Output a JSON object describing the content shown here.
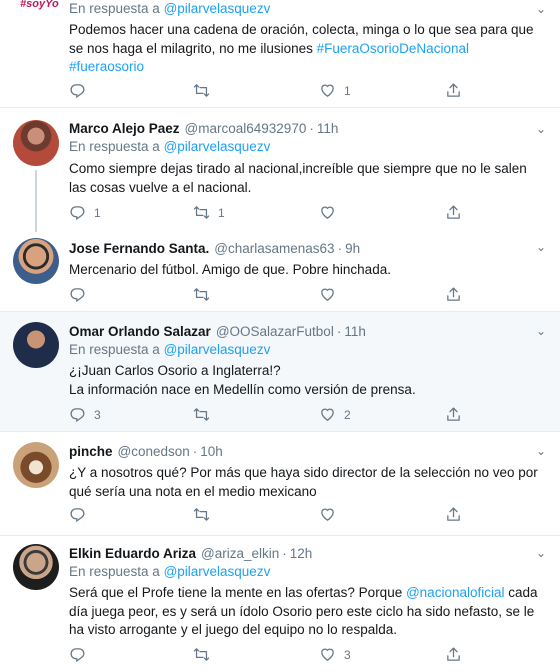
{
  "tweets": [
    {
      "name": "",
      "handle": "",
      "time": "",
      "replying_prefix": "En respuesta a ",
      "replying_to": "@pilarvelasquezv",
      "text_plain": "Podemos hacer una cadena de oración, colecta, minga o lo que sea para que se nos haga el milagrito, no me ilusiones ",
      "text_link1": "#FueraOsorioDeNacional",
      "text_link2": "#fueraosorio",
      "reply_count": "",
      "retweet_count": "",
      "like_count": "1",
      "avatar_text": "#soyYo"
    },
    {
      "name": "Marco Alejo Paez",
      "handle": "@marcoal64932970",
      "time": "11h",
      "replying_prefix": "En respuesta a ",
      "replying_to": "@pilarvelasquezv",
      "text_plain": "Como siempre dejas tirado al nacional,increíble que siempre que no le salen las cosas vuelve a el nacional.",
      "reply_count": "1",
      "retweet_count": "1",
      "like_count": ""
    },
    {
      "name": "Jose Fernando Santa.",
      "handle": "@charlasamenas63",
      "time": "9h",
      "text_plain": "Mercenario del fútbol. Amigo de que. Pobre hinchada.",
      "reply_count": "",
      "retweet_count": "",
      "like_count": ""
    },
    {
      "name": "Omar Orlando Salazar",
      "handle": "@OOSalazarFutbol",
      "time": "11h",
      "replying_prefix": "En respuesta a ",
      "replying_to": "@pilarvelasquezv",
      "text_plain": "¿¡Juan Carlos Osorio a Inglaterra!?\nLa información nace en Medellín como versión de prensa.",
      "reply_count": "3",
      "retweet_count": "",
      "like_count": "2"
    },
    {
      "name": "pinche",
      "handle": "@conedson",
      "time": "10h",
      "text_plain": "¿Y a nosotros qué? Por más que haya sido director de la selección no veo por qué sería una nota en el medio mexicano",
      "reply_count": "",
      "retweet_count": "",
      "like_count": ""
    },
    {
      "name": "Elkin Eduardo Ariza",
      "handle": "@ariza_elkin",
      "time": "12h",
      "replying_prefix": "En respuesta a ",
      "replying_to": "@pilarvelasquezv",
      "text_part1": "Será que el Profe tiene la mente en las ofertas? Porque ",
      "text_link": "@nacionaloficial",
      "text_part2": " cada día juega peor, es y será un ídolo Osorio pero este ciclo ha sido nefasto, se le ha visto arrogante y el juego del equipo no lo respalda.",
      "reply_count": "",
      "retweet_count": "",
      "like_count": "3"
    }
  ],
  "icons": {
    "reply": "reply-icon",
    "retweet": "retweet-icon",
    "like": "heart-icon",
    "share": "share-icon",
    "caret": "chevron-down-icon"
  },
  "colors": {
    "accent": "#1da1f2",
    "muted": "#657786",
    "highlight_bg": "#f5f8fa",
    "divider": "#e6ecf0"
  }
}
